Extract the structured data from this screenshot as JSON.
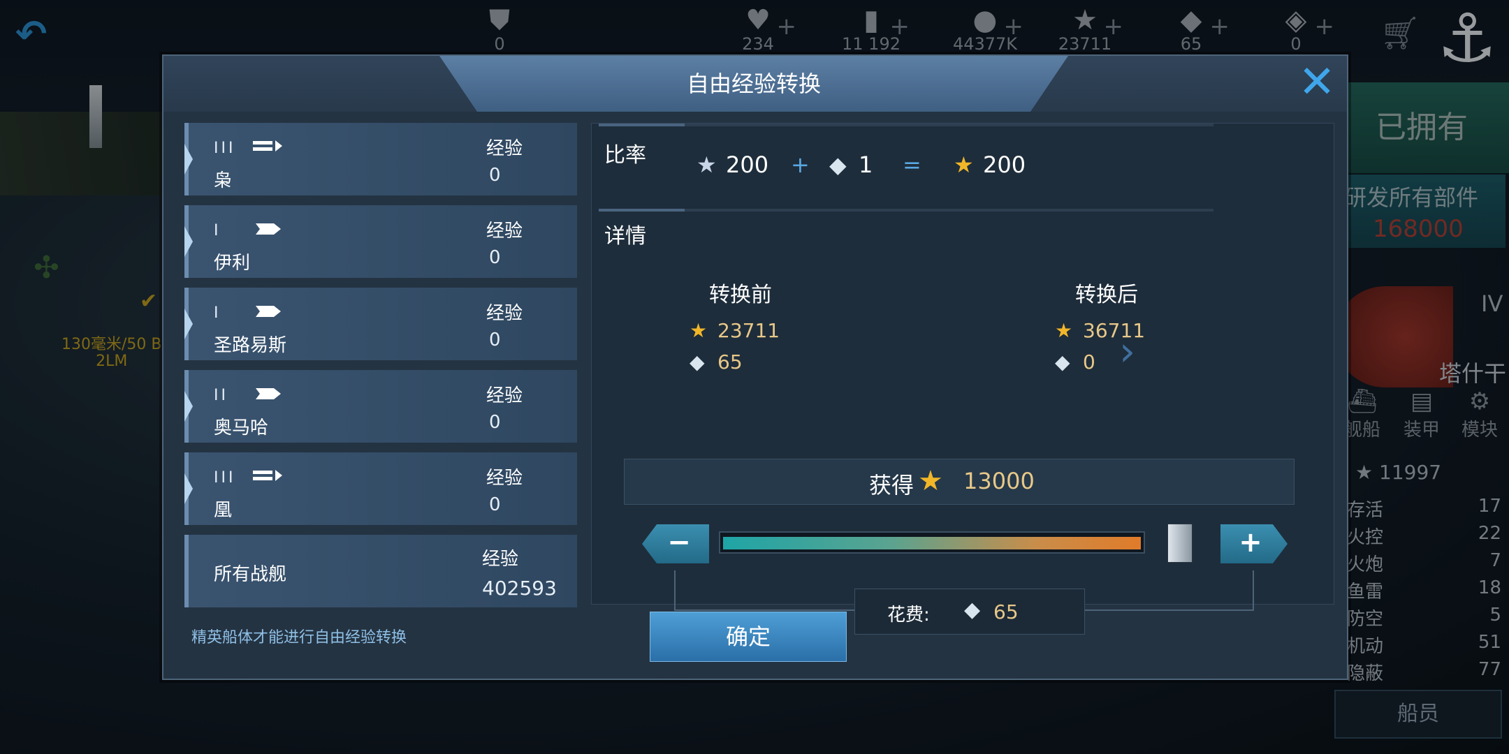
{
  "topbar": {
    "resources": [
      {
        "icon": "rank-badge-icon",
        "glyph": "⛊",
        "value": "0",
        "plus": ""
      },
      {
        "icon": "heart-icon",
        "glyph": "♥",
        "value": "234",
        "plus": "+"
      },
      {
        "icon": "card-icon",
        "glyph": "▮",
        "value": "11 192",
        "plus": "+"
      },
      {
        "icon": "coin-icon",
        "glyph": "●",
        "value": "44377K",
        "plus": "+"
      },
      {
        "icon": "gold-star-icon",
        "glyph": "★",
        "value": "23711",
        "plus": "+"
      },
      {
        "icon": "diamond-icon",
        "glyph": "◆",
        "value": "65",
        "plus": "+"
      },
      {
        "icon": "blue-cube-icon",
        "glyph": "◈",
        "value": "0",
        "plus": "+"
      }
    ]
  },
  "background": {
    "owned_label": "已拥有",
    "research_label": "研发所有部件",
    "research_cost": "168000",
    "tier": "IV",
    "turret_label": "塔什干",
    "tabs": [
      "舰船",
      "装甲",
      "模块"
    ],
    "stat_total": "11997",
    "stats": [
      {
        "name": "存活",
        "value": "17"
      },
      {
        "name": "火控",
        "value": "22"
      },
      {
        "name": "火炮",
        "value": "7"
      },
      {
        "name": "鱼雷",
        "value": "18"
      },
      {
        "name": "防空",
        "value": "5"
      },
      {
        "name": "机动",
        "value": "51"
      },
      {
        "name": "隐蔽",
        "value": "77"
      }
    ],
    "crew_label": "船员",
    "weapon_label_1": "130毫米/50 B",
    "weapon_label_2": "2LM"
  },
  "dialog": {
    "title": "自由经验转换",
    "ships": [
      {
        "tier": "III",
        "name": "枭",
        "exp_label": "经验",
        "exp": "0"
      },
      {
        "tier": "I",
        "name": "伊利",
        "exp_label": "经验",
        "exp": "0"
      },
      {
        "tier": "I",
        "name": "圣路易斯",
        "exp_label": "经验",
        "exp": "0"
      },
      {
        "tier": "II",
        "name": "奥马哈",
        "exp_label": "经验",
        "exp": "0"
      },
      {
        "tier": "III",
        "name": "凰",
        "exp_label": "经验",
        "exp": "0"
      }
    ],
    "all_ships": {
      "label": "所有战舰",
      "exp_label": "经验",
      "exp": "402593"
    },
    "note": "精英船体才能进行自由经验转换",
    "rate": {
      "title": "比率",
      "exp_amount": "200",
      "plus": "+",
      "gem_amount": "1",
      "equals": "=",
      "result_amount": "200"
    },
    "details": {
      "title": "详情",
      "before_title": "转换前",
      "after_title": "转换后",
      "before_star": "23711",
      "before_gem": "65",
      "after_star": "36711",
      "after_gem": "0"
    },
    "gain": {
      "label": "获得",
      "value": "13000"
    },
    "slider": {
      "minus": "−",
      "plus": "+",
      "fraction": 1.0
    },
    "cost": {
      "label": "花费:",
      "value": "65"
    },
    "confirm_label": "确定",
    "colors": {
      "accent": "#3fa6ec",
      "gold": "#f2b629",
      "value_gold": "#e8c889"
    }
  }
}
